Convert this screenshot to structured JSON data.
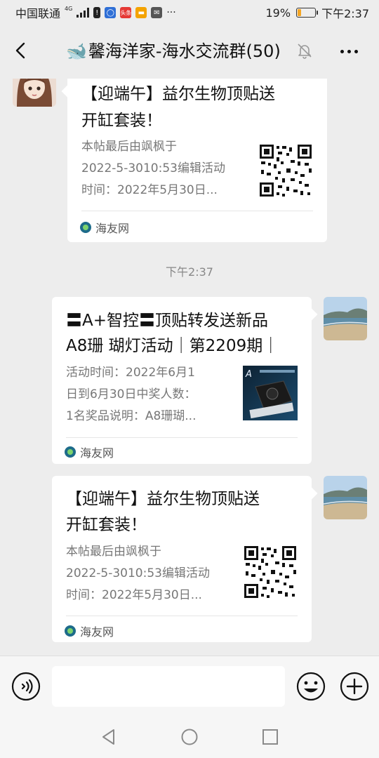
{
  "status_bar": {
    "carrier": "中国联通",
    "network": "4G",
    "battery_text": "19%",
    "battery_level": 0.19,
    "time": "下午2:37",
    "more_dots": "···"
  },
  "header": {
    "group_icon": "whale-emoji",
    "whale_glyph": "🐋",
    "title": "馨海洋家-海水交流群(50)"
  },
  "messages": [
    {
      "side": "left",
      "title_line1": "【迎端午】益尔生物顶贴送",
      "title_line2": "开缸套装！",
      "desc_line1": "本帖最后由飒枫于",
      "desc_line2": "2022-5-3010:53编辑活动",
      "desc_line3": "时间：2022年5月30日...",
      "source": "海友网",
      "thumb": "qr-code"
    },
    {
      "side": "right",
      "title_line1": "〓A+智控〓顶贴转发送新品",
      "title_line2": "A8珊 瑚灯活动｜第2209期｜",
      "desc_line1": "活动时间：2022年6月1",
      "desc_line2": "日到6月30日中奖人数：",
      "desc_line3": "1名奖品说明：A8珊瑚...",
      "source": "海友网",
      "thumb": "product-photo"
    },
    {
      "side": "right",
      "title_line1": "【迎端午】益尔生物顶贴送",
      "title_line2": "开缸套装！",
      "desc_line1": "本帖最后由飒枫于",
      "desc_line2": "2022-5-3010:53编辑活动",
      "desc_line3": "时间：2022年5月30日...",
      "source": "海友网",
      "thumb": "qr-code"
    }
  ],
  "timestamp": "下午2:37",
  "input": {
    "placeholder": ""
  },
  "colors": {
    "background": "#ededed",
    "bubble": "#ffffff",
    "source_icon": "#1d6b8a"
  }
}
